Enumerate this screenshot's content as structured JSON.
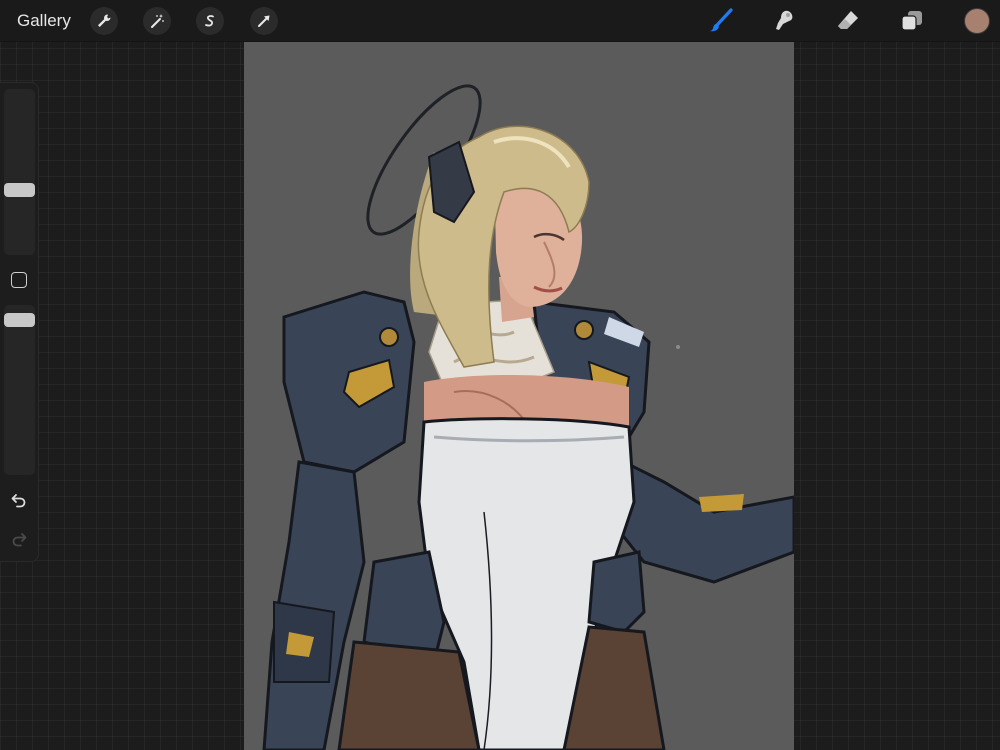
{
  "toolbar": {
    "gallery_label": "Gallery",
    "left_tools": [
      "wrench-icon",
      "magic-wand-icon",
      "selection-icon",
      "transform-arrow-icon"
    ],
    "right_tools": [
      "brush-icon",
      "smudge-icon",
      "eraser-icon",
      "layers-icon"
    ],
    "active_tool": "brush",
    "accent_color": "#1f7cf2",
    "current_color": "#a8806f"
  },
  "sidebar": {
    "brush_size_level": 0.38,
    "opacity_level": 0.95
  },
  "canvas": {
    "background_color": "#5a5b5a"
  }
}
